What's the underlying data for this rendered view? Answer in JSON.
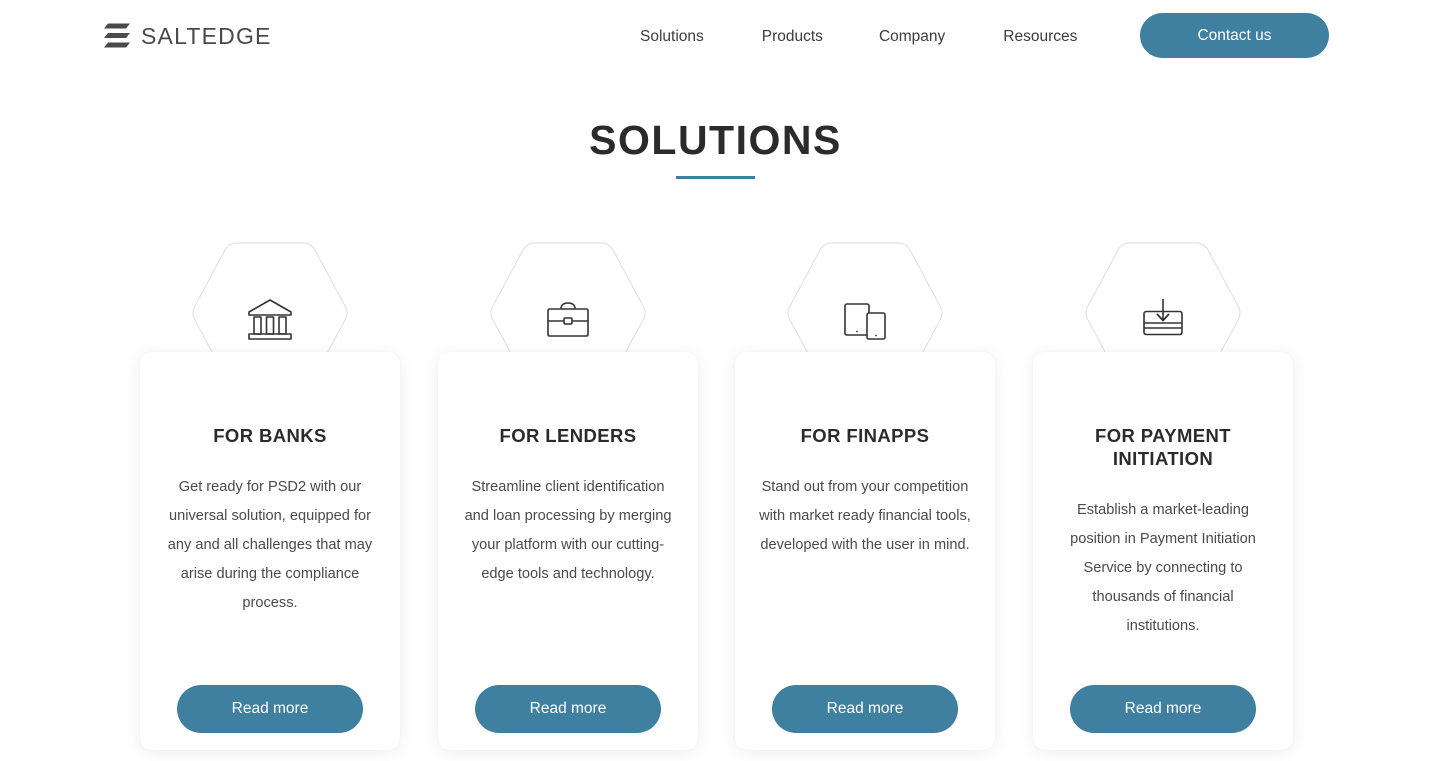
{
  "header": {
    "logo": {
      "mark": "saltedge-bars-icon",
      "text": "SALTEDGE"
    },
    "nav": [
      {
        "label": "Solutions"
      },
      {
        "label": "Products"
      },
      {
        "label": "Company"
      },
      {
        "label": "Resources"
      }
    ],
    "contact_button": {
      "label": "Contact us",
      "color": "#3f7fa0"
    }
  },
  "main": {
    "title": "SOLUTIONS",
    "accent_color": "#3f7fa0",
    "cards": [
      {
        "icon": "bank-building-icon",
        "title": "FOR BANKS",
        "text": "Get ready for PSD2 with our universal solution, equipped for any and all challenges that may arise during the compliance process.",
        "button_label": "Read more"
      },
      {
        "icon": "briefcase-icon",
        "title": "FOR LENDERS",
        "text": "Streamline client identification and loan processing by merging your platform with our cutting-edge tools and technology.",
        "button_label": "Read more"
      },
      {
        "icon": "devices-tablet-phone-icon",
        "title": "FOR FINAPPS",
        "text": "Stand out from your competition with market ready financial tools, developed with the user in mind.",
        "button_label": "Read more"
      },
      {
        "icon": "card-download-icon",
        "title": "FOR PAYMENT INITIATION",
        "text": "Establish a market-leading position in Payment Initiation Service by connecting to thousands of financial institutions.",
        "button_label": "Read more"
      }
    ]
  }
}
